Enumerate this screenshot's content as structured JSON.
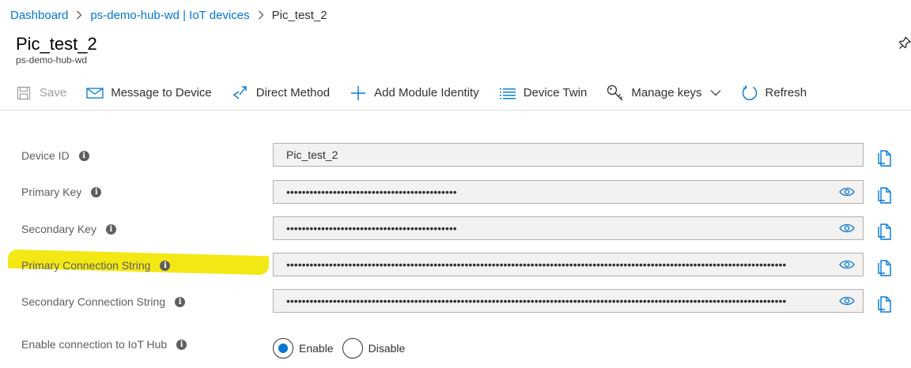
{
  "breadcrumb": {
    "items": [
      "Dashboard",
      "ps-demo-hub-wd | IoT devices"
    ],
    "current": "Pic_test_2"
  },
  "header": {
    "title": "Pic_test_2",
    "subtitle": "ps-demo-hub-wd"
  },
  "toolbar": {
    "save": "Save",
    "message": "Message to Device",
    "direct_method": "Direct Method",
    "add_module": "Add Module Identity",
    "device_twin": "Device Twin",
    "manage_keys": "Manage keys",
    "refresh": "Refresh"
  },
  "fields": {
    "device_id": {
      "label": "Device ID",
      "value": "Pic_test_2"
    },
    "primary_key": {
      "label": "Primary Key",
      "value": "••••••••••••••••••••••••••••••••••••••••••••"
    },
    "secondary_key": {
      "label": "Secondary Key",
      "value": "••••••••••••••••••••••••••••••••••••••••••••"
    },
    "primary_conn": {
      "label": "Primary Connection String",
      "value": "•••••••••••••••••••••••••••••••••••••••••••••••••••••••••••••••••••••••••••••••••••••••••••••••••••••••••••••••••••••••••••••••••"
    },
    "secondary_conn": {
      "label": "Secondary Connection String",
      "value": "•••••••••••••••••••••••••••••••••••••••••••••••••••••••••••••••••••••••••••••••••••••••••••••••••••••••••••••••••••••••••••••••••"
    }
  },
  "connection": {
    "label": "Enable connection to IoT Hub",
    "enable": "Enable",
    "disable": "Disable",
    "selected": "Enable"
  },
  "colors": {
    "accent": "#0078d4",
    "highlight": "#f2e600"
  }
}
